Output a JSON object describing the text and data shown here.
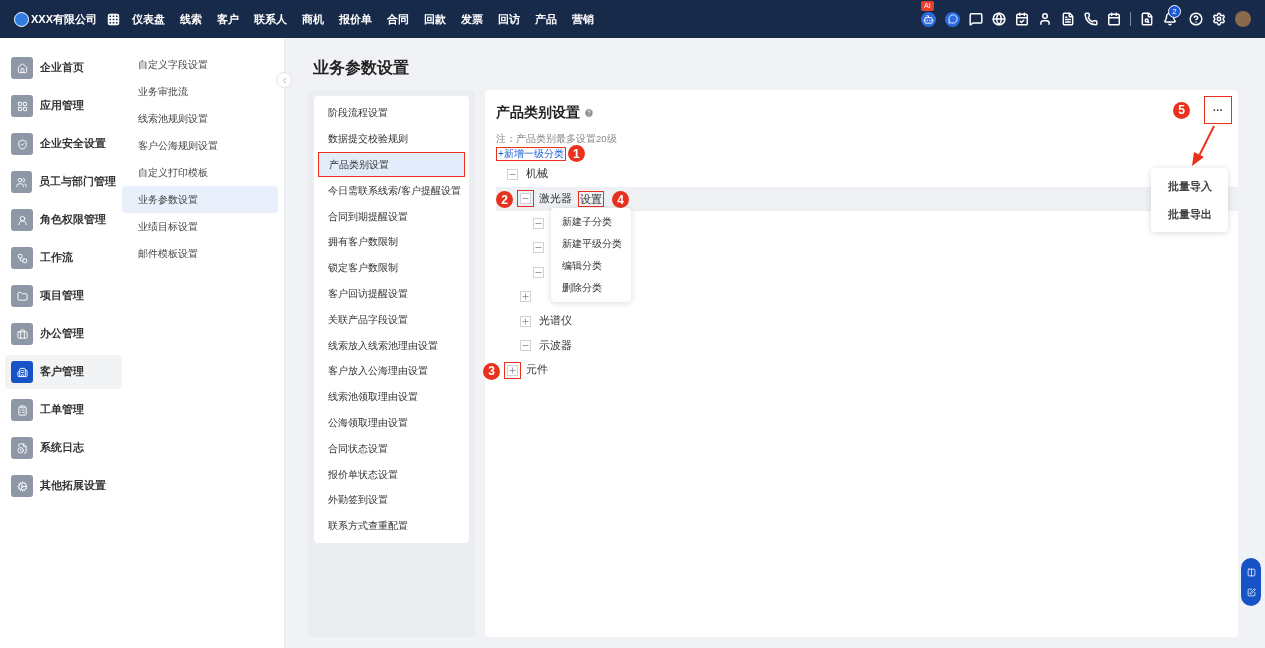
{
  "topbar": {
    "company": "XXX有限公司",
    "nav": [
      "仪表盘",
      "线索",
      "客户",
      "联系人",
      "商机",
      "报价单",
      "合同",
      "回款",
      "发票",
      "回访",
      "产品",
      "营销"
    ],
    "ai_badge": "AI",
    "notification_count": "2"
  },
  "sidebar": {
    "items": [
      {
        "label": "企业首页",
        "selected": false
      },
      {
        "label": "应用管理",
        "selected": false
      },
      {
        "label": "企业安全设置",
        "selected": false
      },
      {
        "label": "员工与部门管理",
        "selected": false
      },
      {
        "label": "角色权限管理",
        "selected": false
      },
      {
        "label": "工作流",
        "selected": false
      },
      {
        "label": "项目管理",
        "selected": false
      },
      {
        "label": "办公管理",
        "selected": false
      },
      {
        "label": "客户管理",
        "selected": true
      },
      {
        "label": "工单管理",
        "selected": false
      },
      {
        "label": "系统日志",
        "selected": false
      },
      {
        "label": "其他拓展设置",
        "selected": false
      }
    ]
  },
  "submenu": {
    "items": [
      {
        "label": "自定义字段设置",
        "selected": false
      },
      {
        "label": "业务审批流",
        "selected": false
      },
      {
        "label": "线索池规则设置",
        "selected": false
      },
      {
        "label": "客户公海规则设置",
        "selected": false
      },
      {
        "label": "自定义打印模板",
        "selected": false
      },
      {
        "label": "业务参数设置",
        "selected": true
      },
      {
        "label": "业绩目标设置",
        "selected": false
      },
      {
        "label": "邮件模板设置",
        "selected": false
      }
    ]
  },
  "page_title": "业务参数设置",
  "settings_list": {
    "items": [
      {
        "label": "阶段流程设置",
        "selected": false
      },
      {
        "label": "数据提交校验规则",
        "selected": false
      },
      {
        "label": "产品类别设置",
        "selected": true
      },
      {
        "label": "今日需联系线索/客户提醒设置",
        "selected": false
      },
      {
        "label": "合同到期提醒设置",
        "selected": false
      },
      {
        "label": "拥有客户数限制",
        "selected": false
      },
      {
        "label": "锁定客户数限制",
        "selected": false
      },
      {
        "label": "客户回访提醒设置",
        "selected": false
      },
      {
        "label": "关联产品字段设置",
        "selected": false
      },
      {
        "label": "线索放入线索池理由设置",
        "selected": false
      },
      {
        "label": "客户放入公海理由设置",
        "selected": false
      },
      {
        "label": "线索池领取理由设置",
        "selected": false
      },
      {
        "label": "公海领取理由设置",
        "selected": false
      },
      {
        "label": "合同状态设置",
        "selected": false
      },
      {
        "label": "报价单状态设置",
        "selected": false
      },
      {
        "label": "外勤签到设置",
        "selected": false
      },
      {
        "label": "联系方式查重配置",
        "selected": false
      }
    ]
  },
  "category_panel": {
    "title": "产品类别设置",
    "note": "注：产品类别最多设置20级",
    "add_link": {
      "label": "+新增一级分类",
      "marker": "1"
    },
    "more_button": {
      "label": "···",
      "marker": "5"
    },
    "more_menu": [
      "批量导入",
      "批量导出"
    ],
    "tree": [
      {
        "label": "机械",
        "expanded": true,
        "children": [
          {
            "label": "激光器",
            "expanded": true,
            "hovered": true,
            "toggle_marker": "2",
            "settings_label": "设置",
            "settings_marker": "4",
            "menu": [
              "新建子分类",
              "新建平级分类",
              "编辑分类",
              "删除分类"
            ],
            "children": [
              {
                "expanded": true
              },
              {
                "expanded": true
              },
              {
                "expanded": true
              }
            ]
          },
          {
            "expanded": false
          },
          {
            "label": "光谱仪",
            "expanded": false
          },
          {
            "label": "示波器",
            "expanded": true
          }
        ]
      },
      {
        "label": "元件",
        "expanded": false,
        "toggle_marker": "3"
      }
    ]
  }
}
